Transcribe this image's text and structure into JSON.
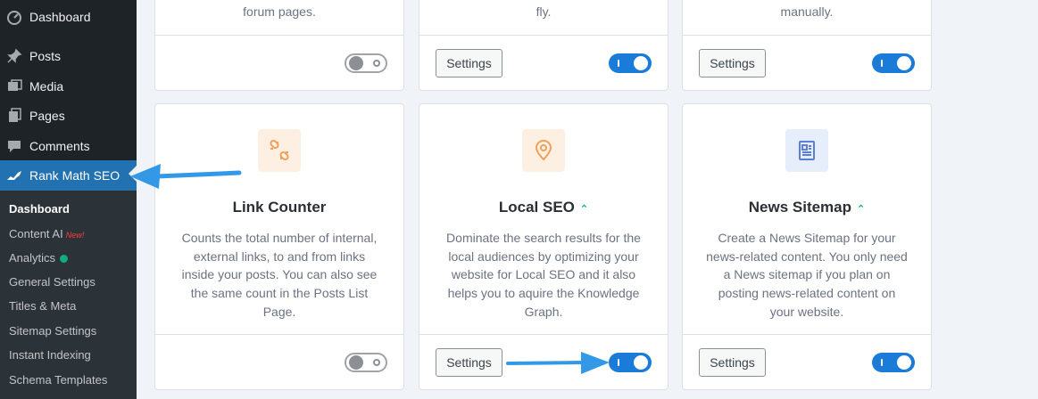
{
  "sidebar": {
    "menu": [
      {
        "label": "Dashboard",
        "icon": "dashboard-icon"
      },
      {
        "label": "Posts",
        "icon": "pin-icon"
      },
      {
        "label": "Media",
        "icon": "media-icon"
      },
      {
        "label": "Pages",
        "icon": "pages-icon"
      },
      {
        "label": "Comments",
        "icon": "comment-icon"
      },
      {
        "label": "Rank Math SEO",
        "icon": "rank-math-icon"
      }
    ],
    "submenu": [
      {
        "label": "Dashboard"
      },
      {
        "label": "Content AI",
        "badge": "New!"
      },
      {
        "label": "Analytics"
      },
      {
        "label": "General Settings"
      },
      {
        "label": "Titles & Meta"
      },
      {
        "label": "Sitemap Settings"
      },
      {
        "label": "Instant Indexing"
      },
      {
        "label": "Schema Templates"
      }
    ]
  },
  "top_cards": [
    {
      "text": "forum pages.",
      "has_settings": false,
      "toggle": "off"
    },
    {
      "text": "fly.",
      "has_settings": true,
      "toggle": "on"
    },
    {
      "text": "manually.",
      "has_settings": true,
      "toggle": "on"
    }
  ],
  "cards": [
    {
      "title": "Link Counter",
      "chevron": false,
      "icon": "link-broken-icon",
      "icon_bg": "#fdf0e3",
      "icon_color": "#f0a05a",
      "lines": [
        "Counts the total number of internal,",
        "external links, to and from links",
        "inside your posts. You can also see",
        "the same count in the Posts List",
        "Page."
      ],
      "has_settings": false,
      "toggle": "off"
    },
    {
      "title": "Local SEO",
      "chevron": true,
      "icon": "location-pin-icon",
      "icon_bg": "#fdf0e3",
      "icon_color": "#f0a05a",
      "lines": [
        "Dominate the search results for the",
        "local audiences by optimizing your",
        "website for Local SEO and it also",
        "helps you to aquire the Knowledge",
        "Graph."
      ],
      "has_settings": true,
      "toggle": "on"
    },
    {
      "title": "News Sitemap",
      "chevron": true,
      "icon": "newspaper-icon",
      "icon_bg": "#e6eefc",
      "icon_color": "#5b7fd6",
      "lines": [
        "Create a News Sitemap for your",
        "news-related content. You only need",
        "a News sitemap if you plan on",
        "posting news-related content on",
        "your website."
      ],
      "has_settings": true,
      "toggle": "on"
    }
  ],
  "buttons": {
    "settings_label": "Settings"
  },
  "chevron_glyph": "≈",
  "colors": {
    "accent": "#2271b1",
    "toggle_on": "#1a7bd8",
    "arrow": "#3399e6",
    "new_badge": "#ff3b3b",
    "analytics_dot": "#10ac84"
  }
}
